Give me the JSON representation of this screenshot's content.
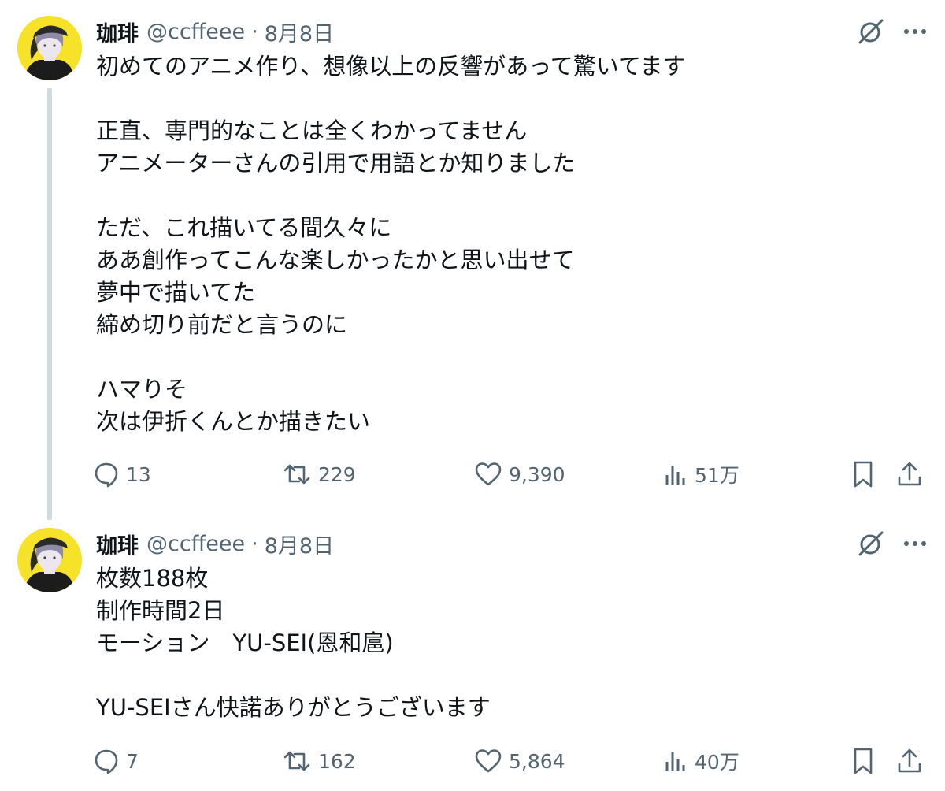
{
  "tweets": [
    {
      "author": {
        "name": "珈琲",
        "handle": "@ccffeee"
      },
      "separator": "·",
      "date": "8月8日",
      "lines": [
        "初めてのアニメ作り、想像以上の反響があって驚いてます",
        "",
        "正直、専門的なことは全くわかってません",
        "アニメーターさんの引用で用語とか知りました",
        "",
        "ただ、これ描いてる間久々に",
        "ああ創作ってこんな楽しかったかと思い出せて",
        "夢中で描いてた",
        "締め切り前だと言うのに",
        "",
        "ハマりそ",
        "次は伊折くんとか描きたい"
      ],
      "stats": {
        "replies": "13",
        "retweets": "229",
        "likes": "9,390",
        "views": "51万"
      }
    },
    {
      "author": {
        "name": "珈琲",
        "handle": "@ccffeee"
      },
      "separator": "·",
      "date": "8月8日",
      "lines": [
        "枚数188枚",
        "制作時間2日",
        "モーション　YU-SEI(恩和扈)",
        "",
        "YU-SEIさん快諾ありがとうございます"
      ],
      "stats": {
        "replies": "7",
        "retweets": "162",
        "likes": "5,864",
        "views": "40万"
      }
    }
  ],
  "icons": {
    "grok": "grok-icon",
    "more": "more-dots-icon",
    "reply": "reply-bubble-icon",
    "retweet": "retweet-icon",
    "like": "heart-icon",
    "views": "views-bar-chart-icon",
    "bookmark": "bookmark-icon",
    "share": "share-upload-icon"
  },
  "colors": {
    "text_primary": "#0f1419",
    "text_secondary": "#536471",
    "thread_line": "#cfd9de",
    "avatar_background": "#f7e22a"
  }
}
